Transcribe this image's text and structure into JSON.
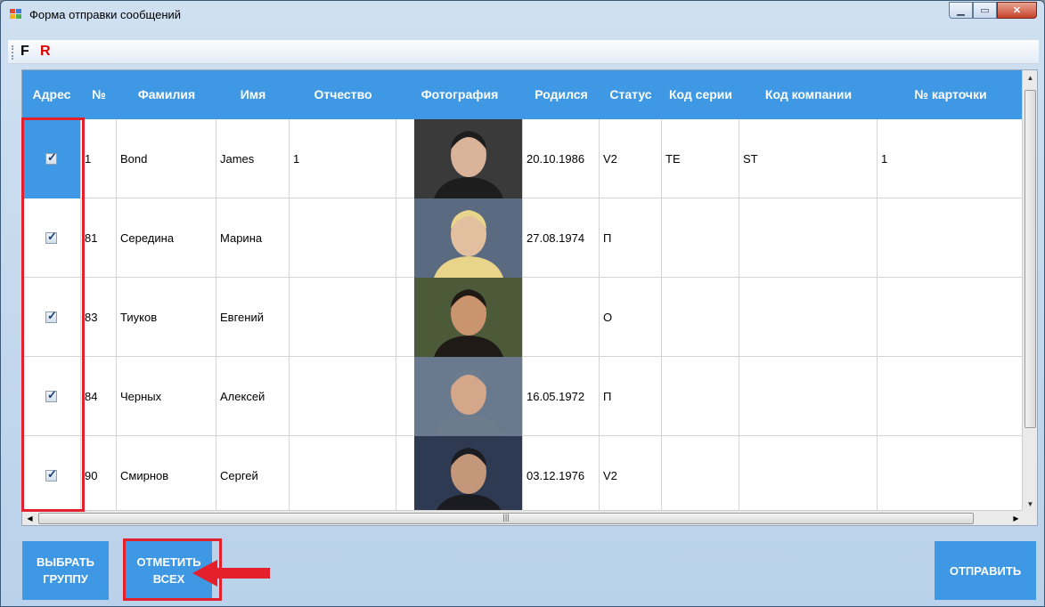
{
  "window": {
    "title": "Форма отправки сообщений"
  },
  "toolbar": {
    "f_label": "F",
    "r_label": "R"
  },
  "grid": {
    "columns": [
      "Адрес",
      "№",
      "Фамилия",
      "Имя",
      "Отчество",
      "Фотография",
      "Родился",
      "Статус",
      "Код серии",
      "Код компании",
      "№ карточки"
    ],
    "rows": [
      {
        "no": "1",
        "surname": "Bond",
        "name": "James",
        "patronymic": "1",
        "born": "20.10.1986",
        "status": "V2",
        "series": "TE",
        "company": "ST",
        "card": "1",
        "checked": true
      },
      {
        "no": "81",
        "surname": "Середина",
        "name": "Марина",
        "patronymic": "",
        "born": "27.08.1974",
        "status": "П",
        "series": "",
        "company": "",
        "card": "",
        "checked": true
      },
      {
        "no": "83",
        "surname": "Тиуков",
        "name": "Евгений",
        "patronymic": "",
        "born": "",
        "status": "О",
        "series": "",
        "company": "",
        "card": "",
        "checked": true
      },
      {
        "no": "84",
        "surname": "Черных",
        "name": "Алексей",
        "patronymic": "",
        "born": "16.05.1972",
        "status": "П",
        "series": "",
        "company": "",
        "card": "",
        "checked": true
      },
      {
        "no": "90",
        "surname": "Смирнов",
        "name": "Сергей",
        "patronymic": "",
        "born": "03.12.1976",
        "status": "V2",
        "series": "",
        "company": "",
        "card": "",
        "checked": true
      }
    ]
  },
  "buttons": {
    "select_group": "ВЫБРАТЬ ГРУППУ",
    "check_all": "ОТМЕТИТЬ ВСЕХ",
    "send": "ОТПРАВИТЬ"
  },
  "colors": {
    "accent": "#3e98e4",
    "highlight": "#e3202b"
  }
}
